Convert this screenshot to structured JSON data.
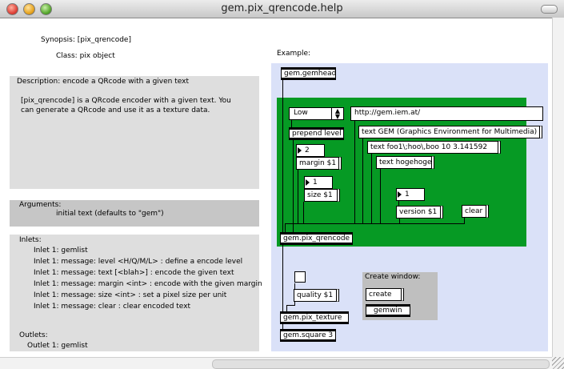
{
  "window": {
    "title": "gem.pix_qrencode.help"
  },
  "synopsis": {
    "label": "Synopsis:",
    "value": "[pix_qrencode]"
  },
  "class": {
    "label": "Class:",
    "value": "pix object"
  },
  "description": {
    "line1": "Description: encode a QRcode with a given text",
    "line2": "[pix_qrencode] is a QRcode encoder with a given text. You",
    "line3": "can generate a QRcode and use it as a texture data."
  },
  "arguments": {
    "header": "Arguments:",
    "item": "initial text (defaults to \"gem\")"
  },
  "inlets": {
    "header": "Inlets:",
    "items": [
      "Inlet 1: gemlist",
      "Inlet 1: message: level <H/Q/M/L> : define a encode level",
      "Inlet 1: message: text [<blah>] : encode the given text",
      "Inlet 1: message: margin <int> : encode with the given margin",
      "Inlet 1: message: size <int> : set a pixel size per unit",
      "Inlet 1: message: clear : clear encoded text"
    ]
  },
  "outlets": {
    "header": "Outlets:",
    "item": "Outlet 1: gemlist"
  },
  "example": {
    "label": "Example:",
    "gemhead": "gem.gemhead",
    "level_dropdown": "Low",
    "url_field": "http://gem.iem.at/",
    "prepend": "prepend level",
    "text_gem": "text GEM (Graphics Environment for Multimedia)",
    "text_foo": "text foo1\\;hoo\\,boo 10 3.141592",
    "text_hoge": "text hogehoge",
    "margin_num": "2",
    "margin_msg": "margin $1",
    "size_num": "1",
    "size_msg": "size $1",
    "version_num": "1",
    "version_msg": "version $1",
    "clear_msg": "clear",
    "qrencode": "gem.pix_qrencode",
    "quality_msg": "quality $1",
    "texture": "gem.pix_texture",
    "square": "gem.square 3",
    "create_window_label": "Create window:",
    "create_msg": "create",
    "gemwin": "gemwin"
  },
  "colors": {
    "example_bg": "#dae1f8",
    "green_subpatch": "#069a24",
    "panel_gray": "#dedede"
  }
}
